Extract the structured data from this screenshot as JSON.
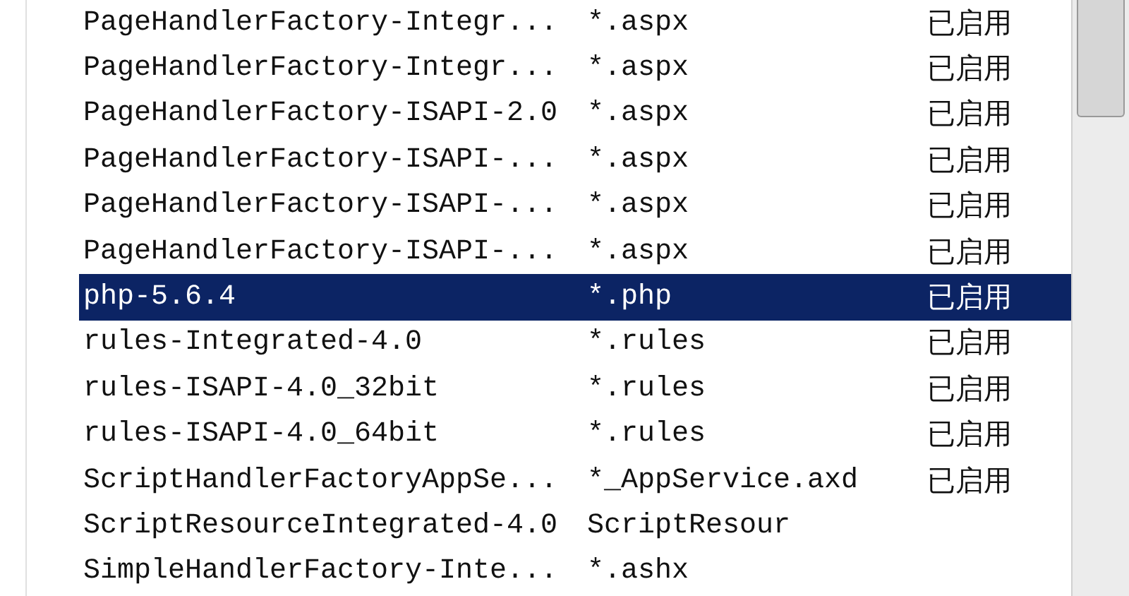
{
  "rows": [
    {
      "name": "PageHandlerFactory-Integr...",
      "path": "*.aspx",
      "status": "已启用",
      "selected": false
    },
    {
      "name": "PageHandlerFactory-Integr...",
      "path": "*.aspx",
      "status": "已启用",
      "selected": false
    },
    {
      "name": "PageHandlerFactory-ISAPI-2.0",
      "path": "*.aspx",
      "status": "已启用",
      "selected": false
    },
    {
      "name": "PageHandlerFactory-ISAPI-...",
      "path": "*.aspx",
      "status": "已启用",
      "selected": false
    },
    {
      "name": "PageHandlerFactory-ISAPI-...",
      "path": "*.aspx",
      "status": "已启用",
      "selected": false
    },
    {
      "name": "PageHandlerFactory-ISAPI-...",
      "path": "*.aspx",
      "status": "已启用",
      "selected": false
    },
    {
      "name": "php-5.6.4",
      "path": "*.php",
      "status": "已启用",
      "selected": true
    },
    {
      "name": "rules-Integrated-4.0",
      "path": "*.rules",
      "status": "已启用",
      "selected": false
    },
    {
      "name": "rules-ISAPI-4.0_32bit",
      "path": "*.rules",
      "status": "已启用",
      "selected": false
    },
    {
      "name": "rules-ISAPI-4.0_64bit",
      "path": "*.rules",
      "status": "已启用",
      "selected": false
    },
    {
      "name": "ScriptHandlerFactoryAppSe...",
      "path": "*_AppService.axd",
      "status": "已启用",
      "selected": false
    },
    {
      "name": "ScriptResourceIntegrated-4.0",
      "path": "ScriptResour",
      "selected": false
    },
    {
      "name": "SimpleHandlerFactory-Inte...",
      "path": "*.ashx",
      "selected": false
    }
  ]
}
